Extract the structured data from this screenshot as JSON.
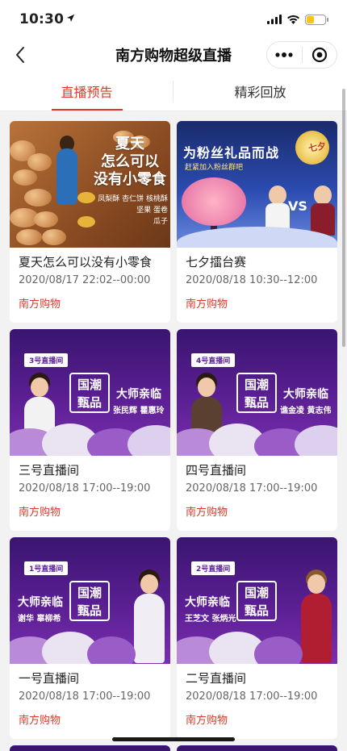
{
  "status_bar": {
    "time": "10:30",
    "location_icon": "location-arrow-icon",
    "battery_color": "#f5c518"
  },
  "nav": {
    "title": "南方购物超级直播"
  },
  "tabs": [
    {
      "label": "直播预告",
      "active": true
    },
    {
      "label": "精彩回放",
      "active": false
    }
  ],
  "accent_color": "#d93a2b",
  "cards": [
    {
      "title": "夏天怎么可以没有小零食",
      "time": "2020/08/17 22:02--00:00",
      "shop": "南方购物",
      "thumb": {
        "kind": "snack",
        "headline_1": "夏天",
        "headline_2": "怎么可以",
        "headline_3": "没有小零食",
        "products_1": "凤梨酥 杏仁饼 核桃酥",
        "products_2": "坚果 蛋卷",
        "products_3": "瓜子"
      }
    },
    {
      "title": "七夕擂台赛",
      "time": "2020/08/18 10:30--12:00",
      "shop": "南方购物",
      "thumb": {
        "kind": "qixi",
        "banner": "为粉丝礼品而战",
        "sub": "赶紧加入粉丝群吧",
        "moon": "七夕",
        "vs": "VS"
      }
    },
    {
      "title": "三号直播间",
      "time": "2020/08/18 17:00--19:00",
      "shop": "南方购物",
      "thumb": {
        "kind": "studio",
        "tag": "3号直播间",
        "brand_1": "国潮",
        "brand_2": "甄品",
        "master": "大师亲临",
        "names": "张民辉 瞿惠玲"
      }
    },
    {
      "title": "四号直播间",
      "time": "2020/08/18 17:00--19:00",
      "shop": "南方购物",
      "thumb": {
        "kind": "studio",
        "tag": "4号直播间",
        "brand_1": "国潮",
        "brand_2": "甄品",
        "master": "大师亲临",
        "names": "谯金凌 黄志伟"
      }
    },
    {
      "title": "一号直播间",
      "time": "2020/08/18 17:00--19:00",
      "shop": "南方购物",
      "thumb": {
        "kind": "studio",
        "tag": "1号直播间",
        "brand_1": "国潮",
        "brand_2": "甄品",
        "master": "大师亲临",
        "names": "谢华 辜柳希"
      }
    },
    {
      "title": "二号直播间",
      "time": "2020/08/18 17:00--19:00",
      "shop": "南方购物",
      "thumb": {
        "kind": "studio",
        "tag": "2号直播间",
        "brand_1": "国潮",
        "brand_2": "甄品",
        "master": "大师亲临",
        "names": "王芝文 张炳光"
      }
    }
  ]
}
